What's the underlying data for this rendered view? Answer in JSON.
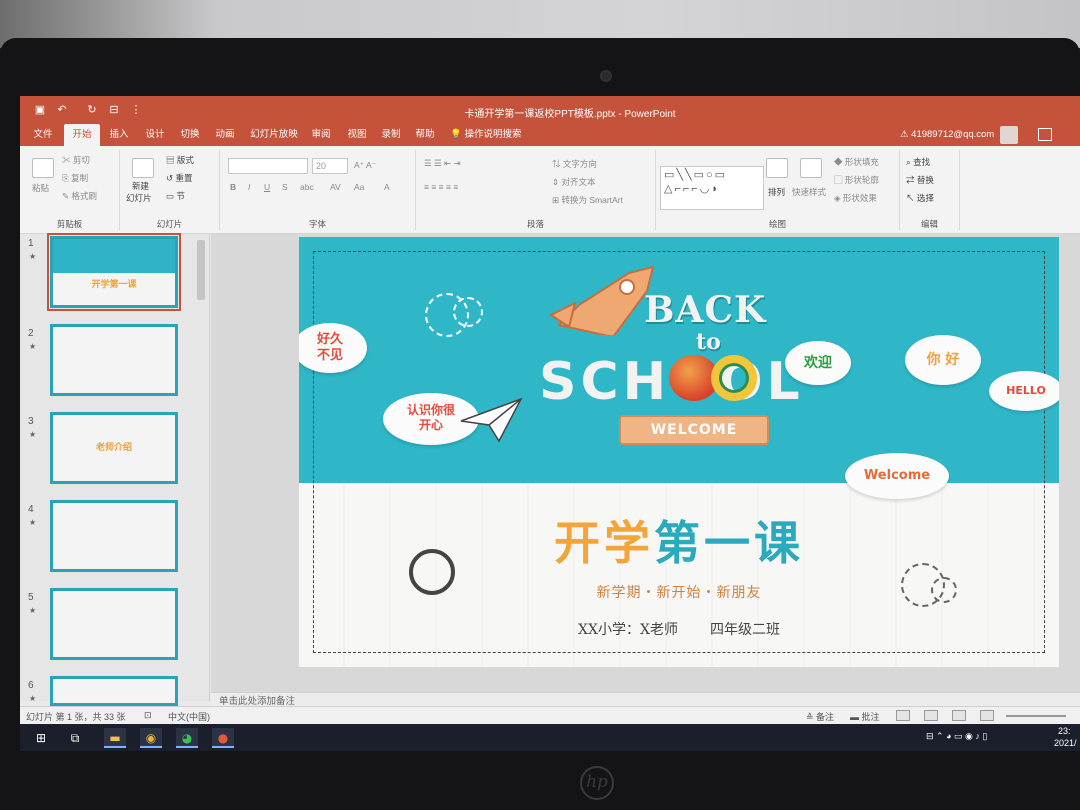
{
  "window": {
    "title": "卡通开学第一课返校PPT模板.pptx  -  PowerPoint"
  },
  "ribbon_tabs": [
    "文件",
    "开始",
    "插入",
    "设计",
    "切换",
    "动画",
    "幻灯片放映",
    "审阅",
    "视图",
    "录制",
    "帮助"
  ],
  "active_tab": "开始",
  "tell_me": "操作说明搜索",
  "account": "41989712@qq.com",
  "ribbon": {
    "clipboard": {
      "cut": "剪切",
      "copy": "复制",
      "paste": "粘贴",
      "format_painter": "格式刷",
      "label": "剪贴板"
    },
    "slides": {
      "new_slide": "新建",
      "new_slide2": "幻灯片",
      "layout": "版式",
      "reset": "重置",
      "section": "节",
      "label": "幻灯片"
    },
    "font": {
      "size": "20",
      "label": "字体"
    },
    "paragraph": {
      "text_direction": "文字方向",
      "align_text": "对齐文本",
      "smartart": "转换为 SmartArt",
      "label": "段落"
    },
    "drawing": {
      "arrange": "排列",
      "quick_styles": "快速样式",
      "shape_fill": "形状填充",
      "shape_outline": "形状轮廓",
      "shape_effects": "形状效果",
      "label": "绘图"
    },
    "editing": {
      "find": "查找",
      "replace": "替换",
      "select": "选择",
      "label": "编辑"
    }
  },
  "thumbnails": [
    {
      "num": "1",
      "title": "开学第一课",
      "selected": true
    },
    {
      "num": "2",
      "title": "",
      "selected": false
    },
    {
      "num": "3",
      "title": "老师介绍",
      "selected": false
    },
    {
      "num": "4",
      "title": "",
      "selected": false
    },
    {
      "num": "5",
      "title": "",
      "selected": false
    },
    {
      "num": "6",
      "title": "",
      "selected": false
    }
  ],
  "slide": {
    "back": "BACK",
    "to": "to",
    "school": "SCHOOL",
    "welcome_banner": "WELCOME",
    "cloud_1": "好久\n不见",
    "cloud_2": "认识你很\n开心",
    "cloud_3": "欢迎",
    "cloud_4": "你 好",
    "cloud_5": "HELLO",
    "cloud_6": "Welcome",
    "title_part1": "开学",
    "title_part2": "第一课",
    "subtitle": "新学期・新开始・新朋友",
    "school_teacher": "XX小学：X老师",
    "class": "四年级二班"
  },
  "notes_placeholder": "单击此处添加备注",
  "statusbar": {
    "slide_info": "幻灯片 第 1 张，共 33 张",
    "language": "中文(中国)",
    "notes": "备注",
    "comments": "批注"
  },
  "taskbar": {
    "time": "23:",
    "date": "2021/"
  },
  "colors": {
    "accent": "#c5523a",
    "slide_teal": "#2fb7c8",
    "title_orange": "#f5a43a",
    "title_teal": "#2aa9bf"
  }
}
